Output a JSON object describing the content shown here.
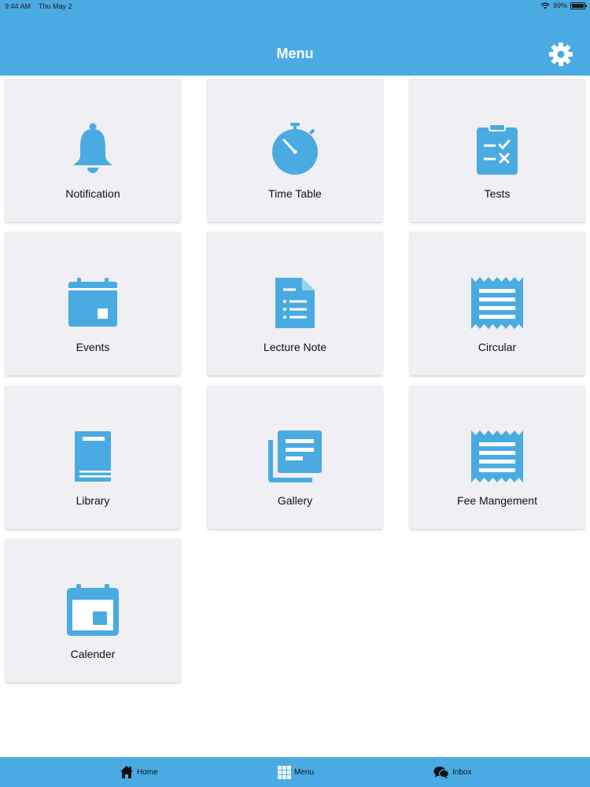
{
  "status_bar": {
    "time": "9:44 AM",
    "date": "Thu May 2",
    "battery": "99%",
    "battery_level": 0.99
  },
  "header": {
    "title": "Menu"
  },
  "icons": {
    "settings": "gear-icon",
    "notification": "bell-icon",
    "time_table": "stopwatch-icon",
    "tests": "clipboard-checklist-icon",
    "events": "calendar-icon",
    "lecture_note": "document-list-icon",
    "circular": "receipt-icon",
    "library": "book-icon",
    "gallery": "stacked-pages-icon",
    "fee_management": "receipt-icon",
    "calender": "calendar-icon",
    "home": "home-icon",
    "menu": "grid-icon",
    "inbox": "chat-bubbles-icon"
  },
  "tiles": [
    {
      "label": "Notification"
    },
    {
      "label": "Time Table"
    },
    {
      "label": "Tests"
    },
    {
      "label": "Events"
    },
    {
      "label": "Lecture Note"
    },
    {
      "label": "Circular"
    },
    {
      "label": "Library"
    },
    {
      "label": "Gallery"
    },
    {
      "label": "Fee Mangement"
    },
    {
      "label": "Calender"
    }
  ],
  "tabbar": {
    "items": [
      {
        "label": "Home"
      },
      {
        "label": "Menu"
      },
      {
        "label": "Inbox"
      }
    ]
  },
  "colors": {
    "accent": "#4aabe3",
    "icon": "#4aabe3",
    "tile_bg": "#f0eff4",
    "text": "#111111"
  }
}
